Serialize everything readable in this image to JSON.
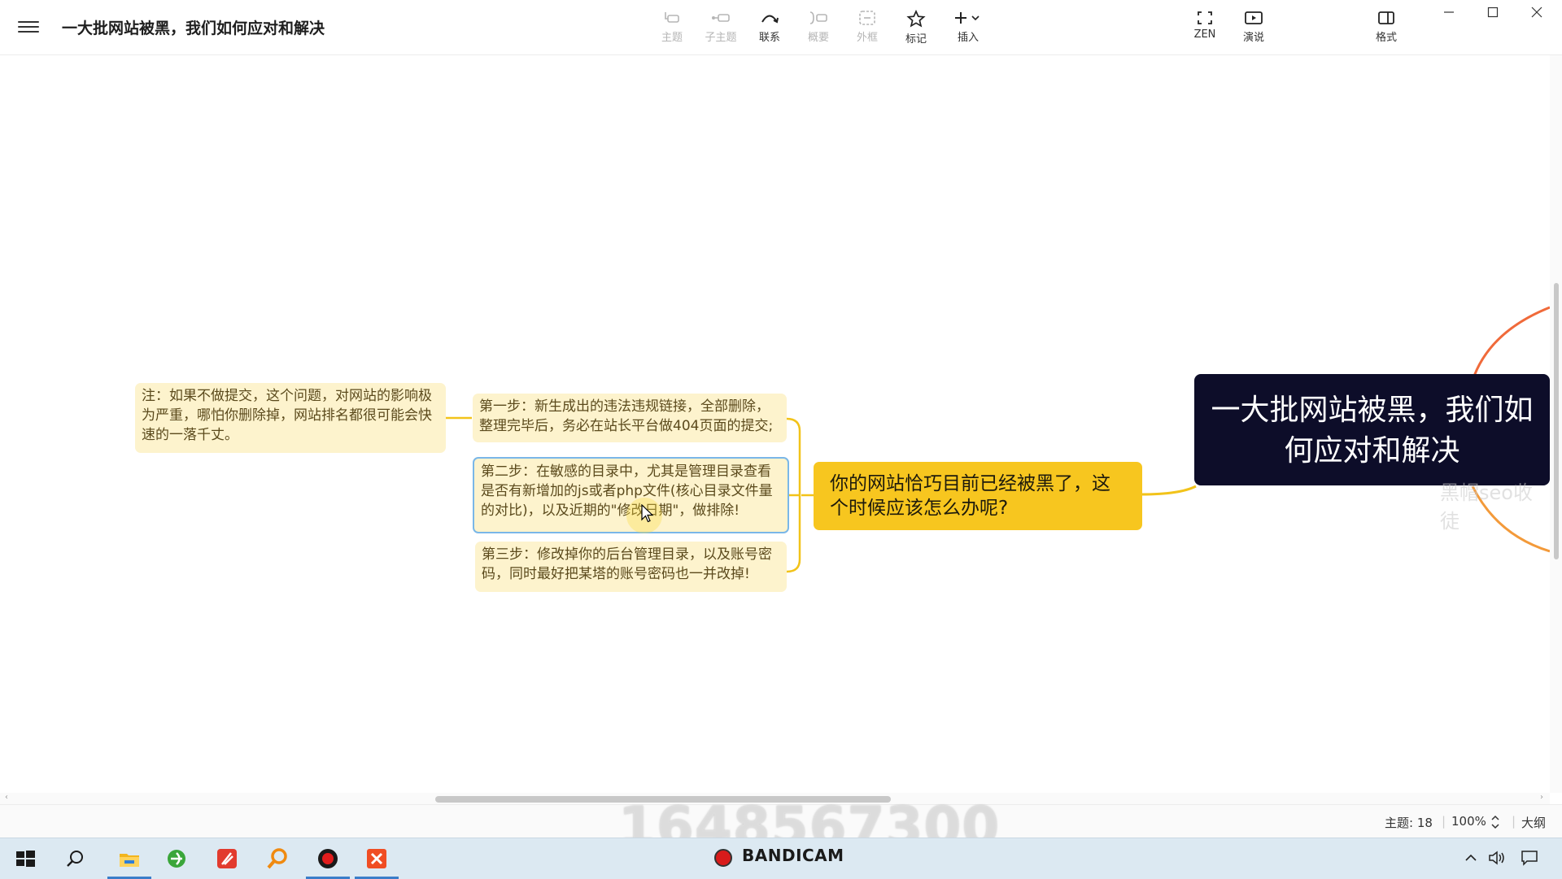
{
  "window": {
    "title": "一大批网站被黑，我们如何应对和解决"
  },
  "toolbar": {
    "items": [
      {
        "label": "主题",
        "icon": "topic-icon",
        "enabled": false
      },
      {
        "label": "子主题",
        "icon": "subtopic-icon",
        "enabled": false
      },
      {
        "label": "联系",
        "icon": "relationship-icon",
        "enabled": true
      },
      {
        "label": "概要",
        "icon": "summary-icon",
        "enabled": false
      },
      {
        "label": "外框",
        "icon": "boundary-icon",
        "enabled": false
      },
      {
        "label": "标记",
        "icon": "star-icon",
        "enabled": true
      },
      {
        "label": "插入",
        "icon": "plus-icon",
        "enabled": true
      },
      {
        "label": "ZEN",
        "icon": "fullscreen-icon",
        "enabled": true
      },
      {
        "label": "演说",
        "icon": "play-icon",
        "enabled": true
      },
      {
        "label": "格式",
        "icon": "panel-icon",
        "enabled": true
      }
    ]
  },
  "mindmap": {
    "root": "一大批网站被黑，我们如何应对和解决",
    "main_branch": "你的网站恰巧目前已经被黑了，这个时候应该怎么办呢?",
    "steps": [
      "第一步：新生成出的违法违规链接，全部删除，整理完毕后，务必在站长平台做404页面的提交;",
      "第二步：在敏感的目录中，尤其是管理目录查看是否有新增加的js或者php文件(核心目录文件量的对比)，以及近期的\"修改日期\"，做排除!",
      "第三步：修改掉你的后台管理目录，以及账号密码，同时最好把某塔的账号密码也一并改掉!"
    ],
    "note": "注：如果不做提交，这个问题，对网站的影响极为严重，哪怕你删除掉，网站排名都很可能会快速的一落千丈。",
    "selected_index": 1,
    "watermark": "黑帽seo收徒",
    "colors": {
      "root_bg": "#0d0d29",
      "branch_bg": "#f7c61f",
      "subtopic_bg": "#fdf3cd",
      "line": "#f2c31a",
      "selection": "#7ab7e8"
    }
  },
  "statusbar": {
    "topic_count_label": "主题: 18",
    "zoom": "100%",
    "outline_label": "大纲"
  },
  "overlay": {
    "number": "1648567300",
    "recorder": "BANDICAM"
  },
  "taskbar": {
    "apps": [
      "start-icon",
      "search-icon",
      "file-explorer-icon",
      "browser-icon",
      "app-red-icon",
      "magnifier-icon",
      "record-icon",
      "xmind-icon"
    ]
  }
}
